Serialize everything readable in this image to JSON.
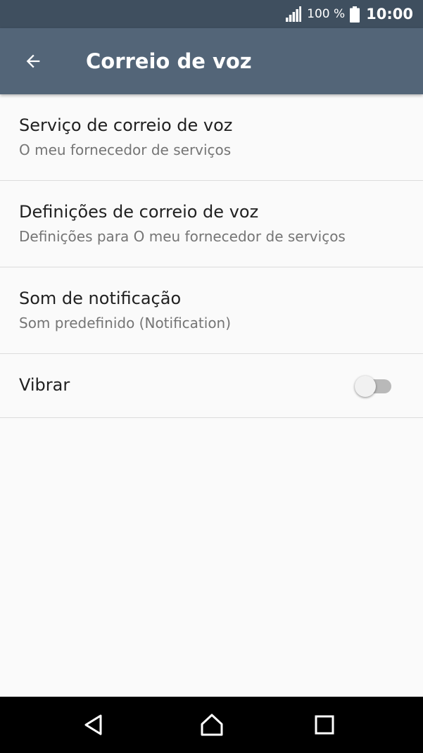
{
  "status_bar": {
    "battery_percent": "100 %",
    "time": "10:00",
    "icons": [
      "signal-icon",
      "battery-icon"
    ]
  },
  "app_bar": {
    "title": "Correio de voz",
    "back_icon": "arrow-left-icon"
  },
  "settings": [
    {
      "title": "Serviço de correio de voz",
      "summary": "O meu fornecedor de serviços"
    },
    {
      "title": "Definições de correio de voz",
      "summary": "Definições para O meu fornecedor de serviços"
    },
    {
      "title": "Som de notificação",
      "summary": "Som predefinido (Notification)"
    }
  ],
  "vibrate": {
    "title": "Vibrar",
    "enabled": false
  },
  "nav_bar": {
    "icons": [
      "back-triangle-icon",
      "home-icon",
      "recents-square-icon"
    ]
  },
  "colors": {
    "status_bar": "#3f4f5f",
    "app_bar": "#536578",
    "background": "#fafafa",
    "nav_bar": "#000000"
  }
}
